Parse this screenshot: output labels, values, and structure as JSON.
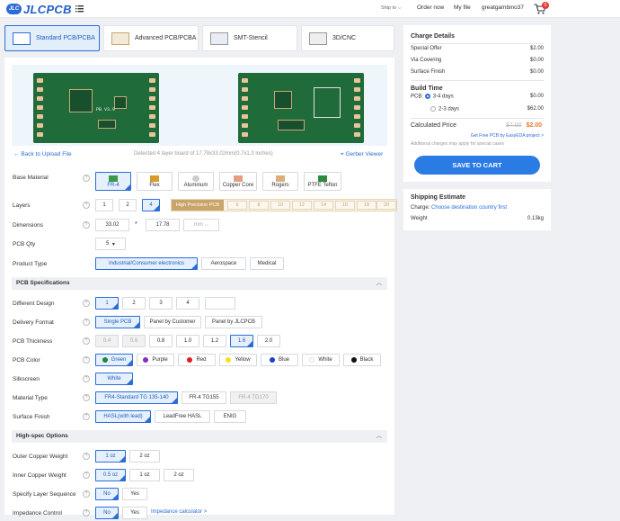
{
  "header": {
    "logo_badge": "JLC",
    "logo_text": "JLCPCB",
    "ship_to": "Ship to",
    "order_now": "Order now",
    "my_file": "My file",
    "username": "greatgambino37",
    "cart_count": "0"
  },
  "tabs": [
    {
      "label": "Standard PCB/PCBA"
    },
    {
      "label": "Advanced PCB/PCBA"
    },
    {
      "label": "SMT-Stencil"
    },
    {
      "label": "3D/CNC"
    }
  ],
  "preview": {
    "back": "Back to Upload File",
    "detected": "Detected 4 layer board of 17.78x33.02mm(0.7x1.3 inches)",
    "gerber": "Gerber Viewer",
    "board_label": "PB V3.9"
  },
  "form": {
    "base_material": {
      "label": "Base Material",
      "options": [
        "FR-4",
        "Flex",
        "Aluminum",
        "Copper Core",
        "Rogers",
        "PTFE Teflon"
      ]
    },
    "layers": {
      "label": "Layers",
      "options": [
        "1",
        "2",
        "4"
      ],
      "hp_label": "High Precision PCB",
      "hp_options": [
        "6",
        "8",
        "10",
        "12",
        "14",
        "16",
        "18",
        "20"
      ]
    },
    "dimensions": {
      "label": "Dimensions",
      "w": "33.02",
      "x": "*",
      "h": "17.78",
      "unit": "mm"
    },
    "qty": {
      "label": "PCB Qty",
      "value": "5"
    },
    "product_type": {
      "label": "Product Type",
      "options": [
        "Industrial/Consumer electronics",
        "Aerospace",
        "Medical"
      ]
    },
    "pcb_spec_header": "PCB Specifications",
    "different_design": {
      "label": "Different Design",
      "options": [
        "1",
        "2",
        "3",
        "4",
        ""
      ]
    },
    "delivery_format": {
      "label": "Delivery Format",
      "options": [
        "Single PCB",
        "Panel by Customer",
        "Panel by JLCPCB"
      ]
    },
    "thickness": {
      "label": "PCB Thickness",
      "options": [
        "0.4",
        "0.6",
        "0.8",
        "1.0",
        "1.2",
        "1.6",
        "2.0"
      ]
    },
    "color": {
      "label": "PCB Color",
      "options": [
        "Green",
        "Purple",
        "Red",
        "Yellow",
        "Blue",
        "White",
        "Black"
      ],
      "swatches": [
        "#1a8a3a",
        "#8a2bc8",
        "#e01e1e",
        "#f5e21a",
        "#1c3fd0",
        "#ffffff",
        "#111111"
      ]
    },
    "silkscreen": {
      "label": "Silkscreen",
      "value": "White"
    },
    "material_type": {
      "label": "Material Type",
      "options": [
        "FR4-Standard TG 135-140",
        "FR-4 TG155",
        "FR-4 TG170"
      ]
    },
    "surface_finish": {
      "label": "Surface Finish",
      "options": [
        "HASL(with lead)",
        "LeadFree HASL",
        "ENIG"
      ]
    },
    "high_spec_header": "High-spec Options",
    "outer_copper": {
      "label": "Outer Copper Weight",
      "options": [
        "1 oz",
        "2 oz"
      ]
    },
    "inner_copper": {
      "label": "Inner Copper Weight",
      "options": [
        "0.5 oz",
        "1 oz",
        "2 oz"
      ]
    },
    "layer_sequence": {
      "label": "Specify Layer Sequence",
      "options": [
        "No",
        "Yes"
      ]
    },
    "impedance": {
      "label": "Impedance Control",
      "options": [
        "No",
        "Yes"
      ],
      "calc": "Impedance calculator >"
    }
  },
  "charges": {
    "title": "Charge Details",
    "lines": [
      {
        "label": "Special Offer",
        "value": "$2.00"
      },
      {
        "label": "Via Covering",
        "value": "$0.00"
      },
      {
        "label": "Surface Finish",
        "value": "$0.00"
      }
    ],
    "build_time_title": "Build Time",
    "pcb_prefix": "PCB:",
    "build_options": [
      {
        "label": "3-4 days",
        "value": "$0.00"
      },
      {
        "label": "2-3 days",
        "value": "$62.00"
      }
    ],
    "calculated_price": "Calculated Price",
    "old_price": "$7.00",
    "new_price": "$2.00",
    "free_pcb": "Get Free PCB by EasyEDA project >",
    "additional": "Additional charges may apply for special cases",
    "save_button": "SAVE TO CART"
  },
  "shipping": {
    "title": "Shipping Estimate",
    "charge_label": "Charge:",
    "charge_link": "Choose destination country first",
    "weight_label": "Weight",
    "weight_value": "0.13kg"
  },
  "colors": {
    "accent": "#2b6dd6",
    "price_red": "#e8782a",
    "hp_gold": "#c9a56a"
  }
}
